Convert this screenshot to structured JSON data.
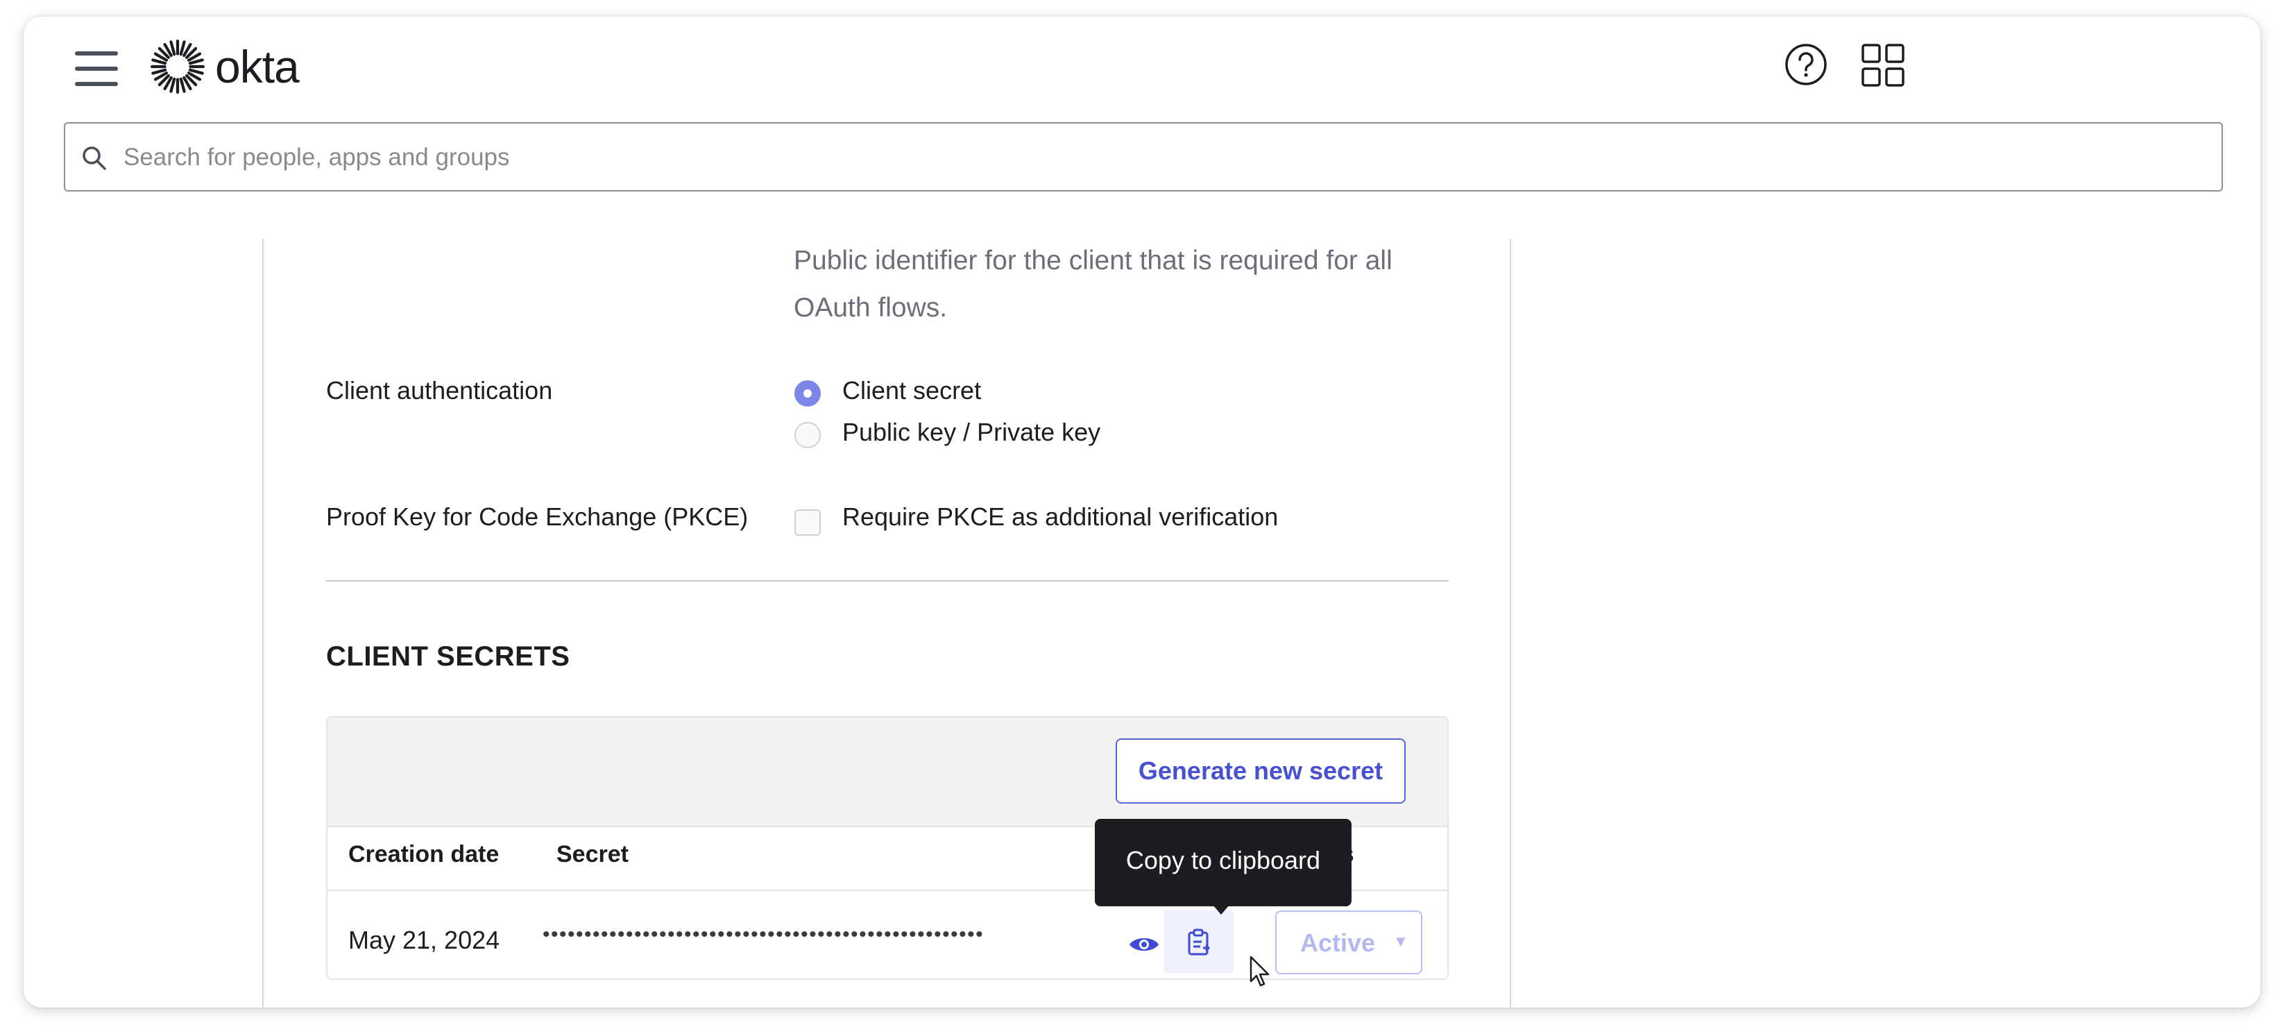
{
  "header": {
    "logo_text": "okta",
    "search_placeholder": "Search for people, apps and groups"
  },
  "client_id": {
    "description": "Public identifier for the client that is required for all OAuth flows."
  },
  "client_authentication": {
    "label": "Client authentication",
    "options": [
      {
        "label": "Client secret",
        "selected": true
      },
      {
        "label": "Public key / Private key",
        "selected": false
      }
    ]
  },
  "pkce": {
    "label": "Proof Key for Code Exchange (PKCE)",
    "checkbox_label": "Require PKCE as additional verification",
    "checked": false
  },
  "client_secrets": {
    "title": "CLIENT SECRETS",
    "generate_button": "Generate new secret",
    "columns": {
      "creation_date": "Creation date",
      "secret": "Secret",
      "status_tail": "us"
    },
    "rows": [
      {
        "creation_date": "May 21, 2024",
        "secret_masked": "•••••••••••••••••••••••••••••••••••••••••••••••••••••",
        "status": "Active"
      }
    ],
    "tooltip": "Copy to clipboard"
  },
  "colors": {
    "accent": "#4751d1",
    "radio_selected": "#7c85e8",
    "tooltip_bg": "#1d1d21"
  }
}
